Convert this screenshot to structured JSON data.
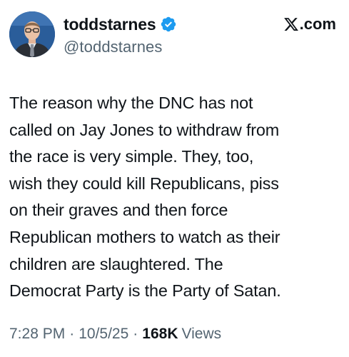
{
  "author": {
    "display_name": "toddstarnes",
    "handle": "@toddstarnes",
    "verified": true,
    "verified_color": "#1d9bf0"
  },
  "brand": {
    "logo_icon": "x-logo-icon",
    "suffix": ".com"
  },
  "tweet": {
    "lines": [
      "The reason why the DNC has not",
      "called on Jay Jones to withdraw from",
      "the race is very simple. They, too,",
      "wish they could kill Republicans, piss",
      "on their graves and then force",
      "Republican mothers to watch as their",
      "children are slaughtered. The",
      "Democrat Party is the Party of Satan."
    ]
  },
  "meta": {
    "time": "7:28 PM",
    "separator": "·",
    "date": "10/5/25",
    "views_count": "168K",
    "views_label": "Views"
  },
  "colors": {
    "text_primary": "#0f1419",
    "text_secondary": "#536471"
  }
}
